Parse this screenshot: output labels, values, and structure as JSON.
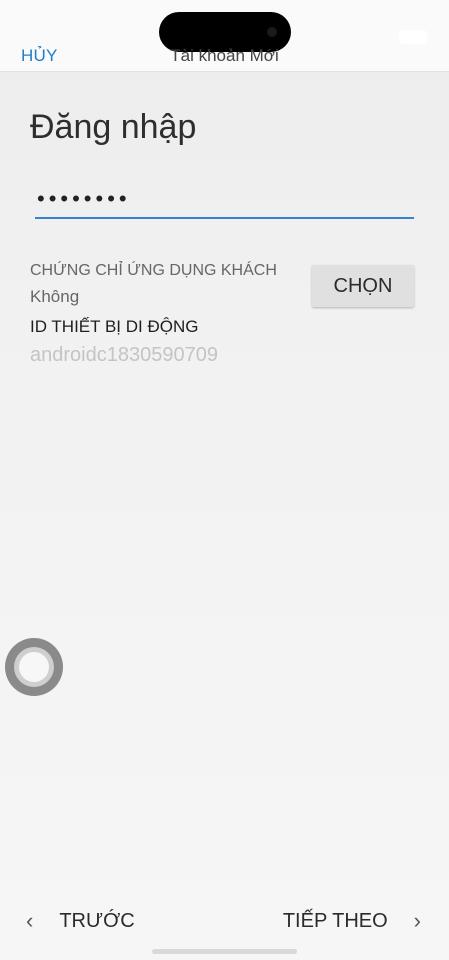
{
  "header": {
    "cancel_label": "HỦY",
    "title": "Tài khoản Mới"
  },
  "main": {
    "heading": "Đăng nhập",
    "password_value": "••••••••",
    "client_cert_label": "CHỨNG CHỈ ỨNG DỤNG KHÁCH",
    "client_cert_value": "Không",
    "choose_label": "CHỌN",
    "device_id_label": "ID THIẾT BỊ DI ĐỘNG",
    "device_id_value": "androidc1830590709"
  },
  "footer": {
    "prev_label": "TRƯỚC",
    "next_label": "TIẾP THEO",
    "prev_icon": "‹",
    "next_icon": "›"
  },
  "colors": {
    "accent": "#1e7fc7",
    "underline": "#3b7fcf",
    "background": "#f2f2f2"
  }
}
